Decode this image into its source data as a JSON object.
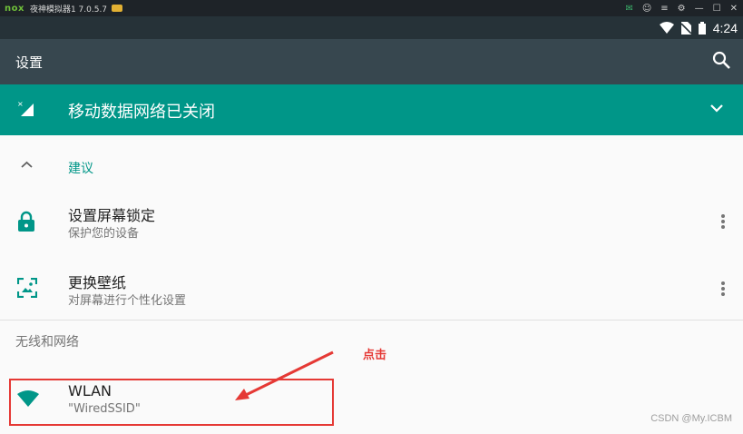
{
  "window": {
    "app_logo": "nox",
    "title": "夜神模拟器1 7.0.5.7"
  },
  "status_bar": {
    "time": "4:24"
  },
  "app_bar": {
    "title": "设置"
  },
  "banner": {
    "text": "移动数据网络已关闭"
  },
  "suggestions": {
    "header": "建议",
    "items": [
      {
        "title": "设置屏幕锁定",
        "subtitle": "保护您的设备",
        "icon": "lock-icon"
      },
      {
        "title": "更换壁纸",
        "subtitle": "对屏幕进行个性化设置",
        "icon": "wallpaper-icon"
      }
    ]
  },
  "section": {
    "title": "无线和网络"
  },
  "wlan": {
    "title": "WLAN",
    "subtitle": "\"WiredSSID\"",
    "icon": "wifi-icon"
  },
  "annotation": {
    "text": "点击",
    "color": "#e53935"
  },
  "watermark": "CSDN @My.ICBM",
  "colors": {
    "accent": "#009688",
    "appbar": "#37474f",
    "statusbar": "#263238"
  }
}
